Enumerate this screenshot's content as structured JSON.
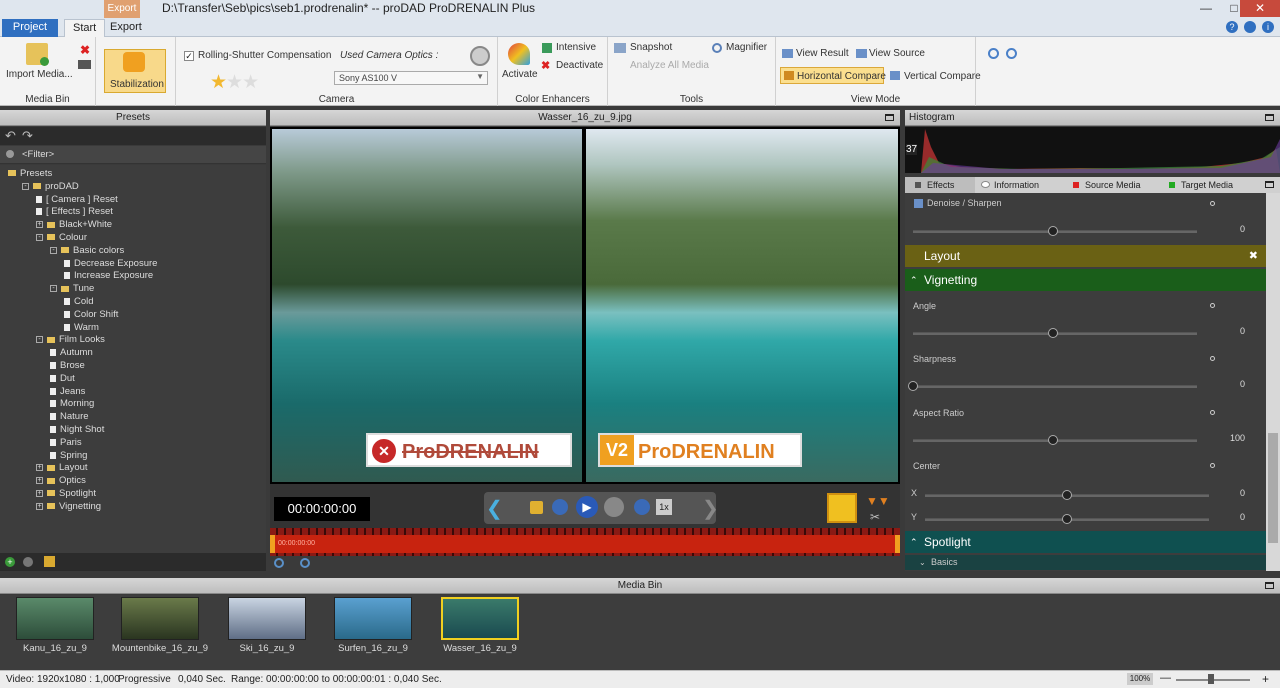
{
  "window": {
    "title": "D:\\Transfer\\Seb\\pics\\seb1.prodrenalin* -- proDAD ProDRENALIN Plus",
    "context_tab": "Export"
  },
  "ribbon_tabs": [
    "Project",
    "Start",
    "Export"
  ],
  "ribbon": {
    "media_bin": {
      "label": "Media Bin",
      "import": "Import Media..."
    },
    "stabilization": {
      "label": "Stabilization"
    },
    "camera": {
      "label": "Camera",
      "rolling_shutter": "Rolling-Shutter Compensation",
      "used_optics": "Used Camera Optics :",
      "optics_value": "Sony AS100 V",
      "rating": 1
    },
    "color": {
      "label": "Color Enhancers",
      "activate": "Activate",
      "intensive": "Intensive",
      "deactivate": "Deactivate"
    },
    "tools": {
      "label": "Tools",
      "snapshot": "Snapshot",
      "magnifier": "Magnifier",
      "analyze": "Analyze All Media"
    },
    "view": {
      "label": "View Mode",
      "view_result": "View Result",
      "view_source": "View Source",
      "horizontal": "Horizontal Compare",
      "vertical": "Vertical Compare"
    }
  },
  "presets": {
    "header": "Presets",
    "filter": "<Filter>",
    "items": [
      {
        "label": "Presets",
        "level": 0,
        "kind": "folder",
        "exp": ""
      },
      {
        "label": "proDAD",
        "level": 1,
        "kind": "folder",
        "exp": "-"
      },
      {
        "label": "[ Camera ]  Reset",
        "level": 2,
        "kind": "doc",
        "exp": ""
      },
      {
        "label": "[ Effects ]  Reset",
        "level": 2,
        "kind": "doc",
        "exp": ""
      },
      {
        "label": "Black+White",
        "level": 2,
        "kind": "folder",
        "exp": "+"
      },
      {
        "label": "Colour",
        "level": 2,
        "kind": "folder",
        "exp": "-"
      },
      {
        "label": "Basic colors",
        "level": 3,
        "kind": "folder",
        "exp": "-"
      },
      {
        "label": "Decrease Exposure",
        "level": 4,
        "kind": "doc",
        "exp": ""
      },
      {
        "label": "Increase Exposure",
        "level": 4,
        "kind": "doc",
        "exp": ""
      },
      {
        "label": "Tune",
        "level": 3,
        "kind": "folder",
        "exp": "-"
      },
      {
        "label": "Cold",
        "level": 4,
        "kind": "doc",
        "exp": ""
      },
      {
        "label": "Color Shift",
        "level": 4,
        "kind": "doc",
        "exp": ""
      },
      {
        "label": "Warm",
        "level": 4,
        "kind": "doc",
        "exp": ""
      },
      {
        "label": "Film Looks",
        "level": 2,
        "kind": "folder",
        "exp": "-"
      },
      {
        "label": "Autumn",
        "level": 3,
        "kind": "doc",
        "exp": ""
      },
      {
        "label": "Brose",
        "level": 3,
        "kind": "doc",
        "exp": ""
      },
      {
        "label": "Dut",
        "level": 3,
        "kind": "doc",
        "exp": ""
      },
      {
        "label": "Jeans",
        "level": 3,
        "kind": "doc",
        "exp": ""
      },
      {
        "label": "Morning",
        "level": 3,
        "kind": "doc",
        "exp": ""
      },
      {
        "label": "Nature",
        "level": 3,
        "kind": "doc",
        "exp": ""
      },
      {
        "label": "Night Shot",
        "level": 3,
        "kind": "doc",
        "exp": ""
      },
      {
        "label": "Paris",
        "level": 3,
        "kind": "doc",
        "exp": ""
      },
      {
        "label": "Spring",
        "level": 3,
        "kind": "doc",
        "exp": ""
      },
      {
        "label": "Layout",
        "level": 2,
        "kind": "folder",
        "exp": "+"
      },
      {
        "label": "Optics",
        "level": 2,
        "kind": "folder",
        "exp": "+"
      },
      {
        "label": "Spotlight",
        "level": 2,
        "kind": "folder",
        "exp": "+"
      },
      {
        "label": "Vignetting",
        "level": 2,
        "kind": "folder",
        "exp": "+"
      }
    ]
  },
  "viewer": {
    "filename": "Wasser_16_zu_9.jpg",
    "timecode": "00:00:00:00",
    "timeline_time": "00:00:00:00",
    "speed": "1x",
    "logo_before": "ProDRENALIN",
    "logo_after": "ProDRENALIN",
    "logo_v2": "V2"
  },
  "right": {
    "histogram": "Histogram",
    "histogram_value": "37",
    "tabs": [
      "Effects",
      "Information",
      "Source Media",
      "Target Media"
    ],
    "denoise": {
      "label": "Denoise / Sharpen",
      "value": "0",
      "level": 0.5
    },
    "layout": "Layout",
    "vignetting": "Vignetting",
    "angle": {
      "label": "Angle",
      "value": "0",
      "level": 0.5
    },
    "sharpness": {
      "label": "Sharpness",
      "value": "0",
      "level": 0.0
    },
    "aspect": {
      "label": "Aspect Ratio",
      "value": "100",
      "level": 0.5
    },
    "center": {
      "label": "Center",
      "x_label": "X",
      "y_label": "Y",
      "x": "0",
      "y": "0"
    },
    "spotlight": "Spotlight",
    "basics": "Basics"
  },
  "media_bin": {
    "header": "Media Bin",
    "items": [
      {
        "label": "Kanu_16_zu_9",
        "colors": [
          "#5a8a6a",
          "#2d4d3a"
        ]
      },
      {
        "label": "Mountenbike_16_zu_9",
        "colors": [
          "#6a7a4a",
          "#2a3520"
        ]
      },
      {
        "label": "Ski_16_zu_9",
        "colors": [
          "#c9d4e2",
          "#5f6e86"
        ]
      },
      {
        "label": "Surfen_16_zu_9",
        "colors": [
          "#5aa0d0",
          "#2a6a8a"
        ]
      },
      {
        "label": "Wasser_16_zu_9",
        "colors": [
          "#3a7a6a",
          "#1a4a50"
        ]
      }
    ]
  },
  "status": {
    "video": "Video: 1920x1080 : 1,000",
    "mode": "Progressive",
    "sec": "0,040 Sec.",
    "range": "Range: 00:00:00:00 to 00:00:00:01 : 0,040 Sec.",
    "zoom": "100%"
  }
}
